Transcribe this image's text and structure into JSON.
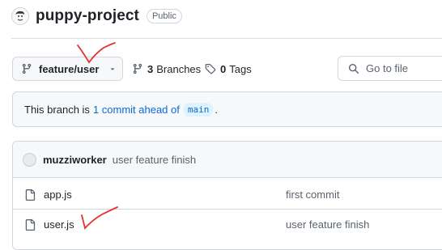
{
  "repo": {
    "name": "puppy-project",
    "visibility": "Public"
  },
  "toolbar": {
    "branch": "feature/user",
    "branches_count": "3",
    "branches_label": "Branches",
    "tags_count": "0",
    "tags_label": "Tags",
    "goto_placeholder": "Go to file"
  },
  "ahead_banner": {
    "prefix": "This branch is",
    "link": "1 commit ahead of",
    "base": "main",
    "suffix": "."
  },
  "latest_commit": {
    "author": "muzziworker",
    "message": "user feature finish"
  },
  "files": [
    {
      "name": "app.js",
      "commit": "first commit",
      "icon": "file-icon"
    },
    {
      "name": "user.js",
      "commit": "user feature finish",
      "icon": "file-icon"
    }
  ],
  "colors": {
    "accent": "#0969da",
    "annotation": "#e5312b",
    "border": "#d0d7de",
    "muted_bg": "#f6f8fa"
  }
}
